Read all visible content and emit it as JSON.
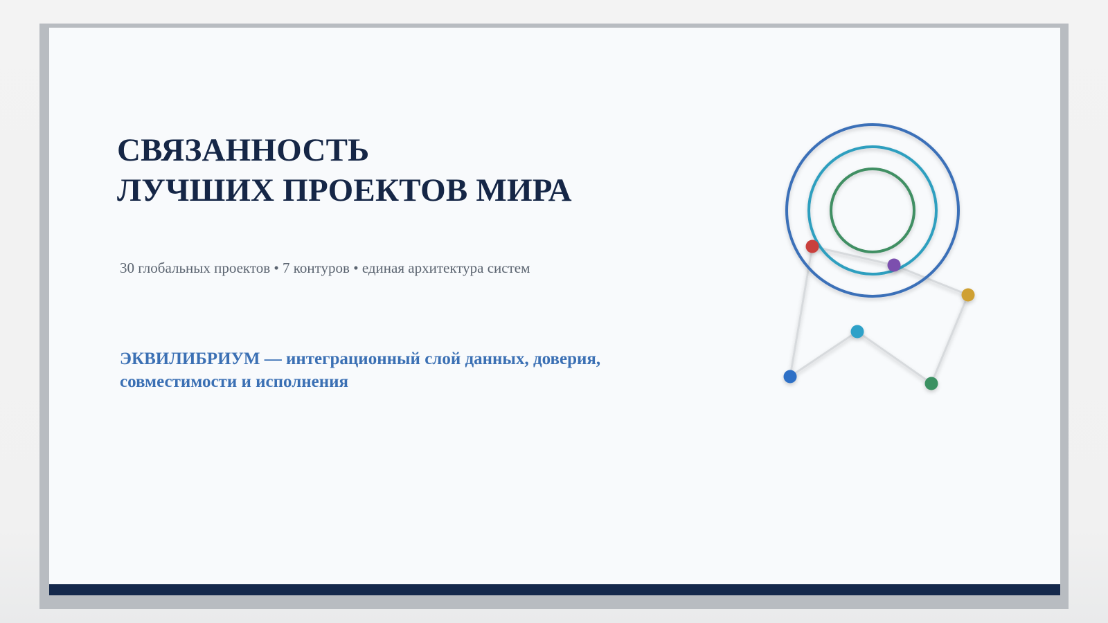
{
  "slide": {
    "title_line1": "СВЯЗАННОСТЬ",
    "title_line2": "ЛУЧШИХ ПРОЕКТОВ МИРА",
    "subtitle": "30 глобальных проектов • 7 контуров • единая архитектура систем",
    "tagline_line1": "ЭКВИЛИБРИУМ — интеграционный слой данных, доверия,",
    "tagline_line2": "совместимости и исполнения"
  },
  "colors": {
    "title": "#152646",
    "subtitle": "#5b6470",
    "accent_blue": "#3b70b4",
    "footer_bar": "#14284b",
    "ring_outer": "#3a6fb8",
    "ring_middle": "#2e9fbf",
    "ring_inner": "#3f8f64",
    "node_red": "#c9403e",
    "node_purple": "#7b4fae",
    "node_gold": "#cfa032",
    "node_teal": "#2fa1c8",
    "node_blue": "#2f6fc6",
    "node_green": "#3a9162"
  },
  "graphic": {
    "icon": "network-rings-icon"
  }
}
